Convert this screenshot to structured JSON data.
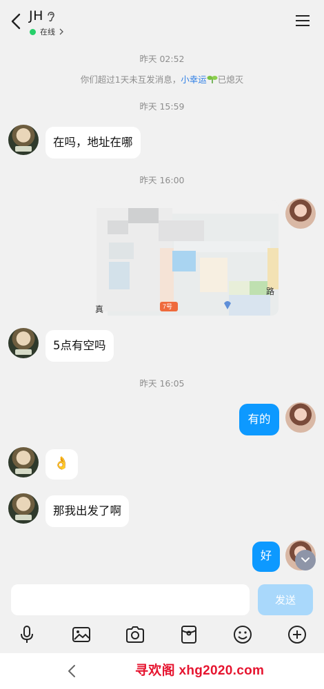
{
  "header": {
    "title": "JH",
    "status": "在线",
    "status_color": "#27d06a"
  },
  "messages": {
    "ts1": "昨天 02:52",
    "sys_prefix": "你们超过1天未互发消息，",
    "sys_link": "小幸运",
    "sys_suffix": "已熄灭",
    "ts2": "昨天 15:59",
    "m1": "在吗，地址在哪",
    "ts3": "昨天 16:00",
    "m2": "5点有空吗",
    "ts4": "昨天 16:05",
    "m3": "有的",
    "m4": "👌",
    "m5": "那我出发了啊",
    "m6": "好"
  },
  "map_card": {
    "labels": [
      "真",
      "7号",
      "路"
    ]
  },
  "composer": {
    "placeholder": "",
    "send_label": "发送"
  },
  "toolbar_icons": [
    "microphone-icon",
    "image-icon",
    "camera-icon",
    "red-packet-icon",
    "emoji-icon",
    "plus-icon"
  ],
  "watermark": "寻欢阁 xhg2020.com",
  "colors": {
    "accent": "#0d99ff",
    "send_disabled": "#a9d8fb",
    "link": "#2f7fe6",
    "watermark": "#e6142f"
  }
}
